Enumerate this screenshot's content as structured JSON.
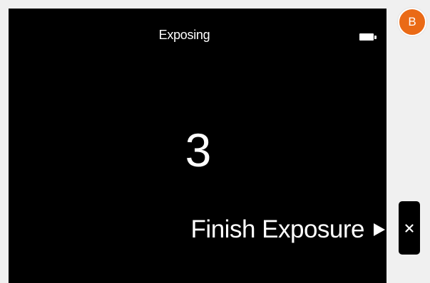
{
  "status": {
    "title": "Exposing",
    "battery_icon": "battery-icon"
  },
  "countdown": {
    "value": "3"
  },
  "finish": {
    "label": "Finish Exposure",
    "icon": "play-triangle-icon"
  },
  "avatar": {
    "initial": "B",
    "color": "#ea6a16"
  },
  "close": {
    "icon": "close-icon"
  }
}
